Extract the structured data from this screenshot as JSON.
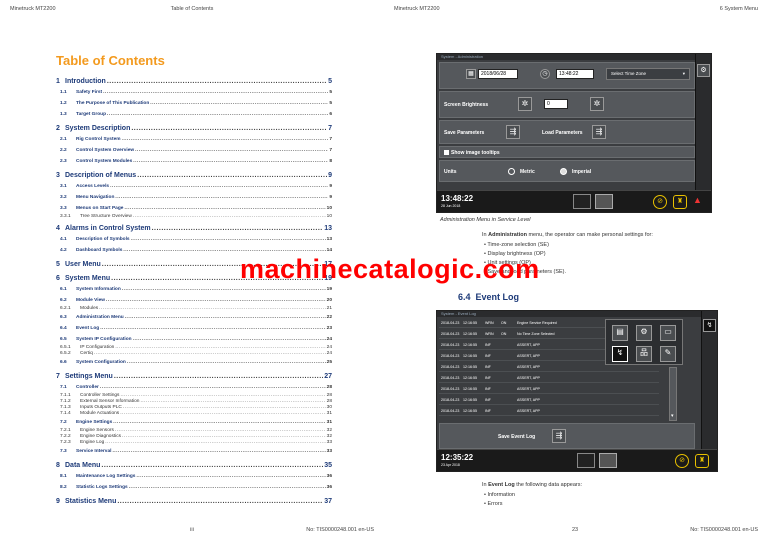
{
  "left_page": {
    "header_left": "Minetruck MT2200",
    "header_center": "Table of Contents",
    "title": "Table of Contents",
    "footer_center": "iii",
    "footer_right": "No: TIS0000248.001 en-US",
    "toc": [
      {
        "level": 1,
        "num": "1",
        "label": "Introduction",
        "page": "5"
      },
      {
        "level": 2,
        "num": "1.1",
        "label": "Safety First",
        "page": "5"
      },
      {
        "level": 2,
        "num": "1.2",
        "label": "The Purpose of This Publication",
        "page": "5"
      },
      {
        "level": 2,
        "num": "1.3",
        "label": "Target Group",
        "page": "6"
      },
      {
        "level": 1,
        "num": "2",
        "label": "System Description",
        "page": "7"
      },
      {
        "level": 2,
        "num": "2.1",
        "label": "Rig Control System",
        "page": "7"
      },
      {
        "level": 2,
        "num": "2.2",
        "label": "Control System Overview",
        "page": "7"
      },
      {
        "level": 2,
        "num": "2.3",
        "label": "Control System Modules",
        "page": "8"
      },
      {
        "level": 1,
        "num": "3",
        "label": "Description of Menus",
        "page": "9"
      },
      {
        "level": 2,
        "num": "3.1",
        "label": "Access Levels",
        "page": "9"
      },
      {
        "level": 2,
        "num": "3.2",
        "label": "Menu Navigation",
        "page": "9"
      },
      {
        "level": 2,
        "num": "3.3",
        "label": "Menus on Start Page",
        "page": "10"
      },
      {
        "level": 3,
        "num": "3.3.1",
        "label": "Tree Structure Overview",
        "page": "10"
      },
      {
        "level": 1,
        "num": "4",
        "label": "Alarms in Control System",
        "page": "13"
      },
      {
        "level": 2,
        "num": "4.1",
        "label": "Description of Symbols",
        "page": "13"
      },
      {
        "level": 2,
        "num": "4.2",
        "label": "Dashboard Symbols",
        "page": "14"
      },
      {
        "level": 1,
        "num": "5",
        "label": "User Menu",
        "page": "17"
      },
      {
        "level": 1,
        "num": "6",
        "label": "System Menu",
        "page": "19"
      },
      {
        "level": 2,
        "num": "6.1",
        "label": "System Information",
        "page": "19"
      },
      {
        "level": 2,
        "num": "6.2",
        "label": "Module View",
        "page": "20"
      },
      {
        "level": 3,
        "num": "6.2.1",
        "label": "Modules",
        "page": "21"
      },
      {
        "level": 2,
        "num": "6.3",
        "label": "Administration Menu",
        "page": "22"
      },
      {
        "level": 2,
        "num": "6.4",
        "label": "Event Log",
        "page": "23"
      },
      {
        "level": 2,
        "num": "6.5",
        "label": "System IP Configuration",
        "page": "24"
      },
      {
        "level": 3,
        "num": "6.5.1",
        "label": "IP Configuration",
        "page": "24"
      },
      {
        "level": 3,
        "num": "6.5.2",
        "label": "Certiq",
        "page": "24"
      },
      {
        "level": 2,
        "num": "6.6",
        "label": "System Configuration",
        "page": "25"
      },
      {
        "level": 1,
        "num": "7",
        "label": "Settings Menu",
        "page": "27"
      },
      {
        "level": 2,
        "num": "7.1",
        "label": "Controller",
        "page": "28"
      },
      {
        "level": 3,
        "num": "7.1.1",
        "label": "Controller Settings",
        "page": "28"
      },
      {
        "level": 3,
        "num": "7.1.2",
        "label": "External Sensor Information",
        "page": "28"
      },
      {
        "level": 3,
        "num": "7.1.3",
        "label": "Inputs Outputs PLC",
        "page": "30"
      },
      {
        "level": 3,
        "num": "7.1.4",
        "label": "Module Actuations",
        "page": "31"
      },
      {
        "level": 2,
        "num": "7.2",
        "label": "Engine Settings",
        "page": "31"
      },
      {
        "level": 3,
        "num": "7.2.1",
        "label": "Engine Sensors",
        "page": "32"
      },
      {
        "level": 3,
        "num": "7.2.2",
        "label": "Engine Diagnostics",
        "page": "32"
      },
      {
        "level": 3,
        "num": "7.2.3",
        "label": "Engine Log",
        "page": "33"
      },
      {
        "level": 2,
        "num": "7.3",
        "label": "Service Interval",
        "page": "33"
      },
      {
        "level": 1,
        "num": "8",
        "label": "Data Menu",
        "page": "35"
      },
      {
        "level": 2,
        "num": "8.1",
        "label": "Maintenance Log Settings",
        "page": "36"
      },
      {
        "level": 2,
        "num": "8.2",
        "label": "Statistic Logs Settings",
        "page": "36"
      },
      {
        "level": 1,
        "num": "9",
        "label": "Statistics Menu",
        "page": "37"
      }
    ]
  },
  "right_page": {
    "header_left": "Minetruck MT2200",
    "header_right": "6 System Menu",
    "footer_left": "23",
    "footer_right": "No: TIS0000248.001 en-US",
    "admin_screen": {
      "breadcrumb": "System - Administration",
      "date": "2018/06/28",
      "time": "13:48:22",
      "tz_button": "Select Time Zone",
      "brightness_label": "Screen Brightness",
      "brightness_value": "0",
      "save_params": "Save Parameters",
      "load_params": "Load Parameters",
      "tooltips": "Show image tooltips",
      "units_label": "Units",
      "metric": "Metric",
      "imperial": "Imperial",
      "clock": "13:48:22",
      "clock_date": "28 Jun 2018"
    },
    "admin_caption": "Administration Menu in Service Level",
    "admin_intro_1": "In ",
    "admin_intro_bold": "Administration",
    "admin_intro_2": " menu, the operator can make personal settings for:",
    "admin_bullets": [
      "Time-zone selection (SE)",
      "Display brightness (OP)",
      "Unit settings (OP)",
      "Save and load parameters (SE)."
    ],
    "event_section_num": "6.4",
    "event_section_title": "Event Log",
    "event_screen": {
      "breadcrumb": "System - Event Log",
      "rows": [
        {
          "date": "2018-04-23",
          "time": "12:16:55",
          "level": "WRN",
          "state": "ON",
          "msg": "Engine Service Required"
        },
        {
          "date": "2018-04-23",
          "time": "12:16:55",
          "level": "WRN",
          "state": "ON",
          "msg": "No Time Zone Selected"
        },
        {
          "date": "2018-04-23",
          "time": "12:16:55",
          "level": "INF",
          "state": "",
          "msg": "ASSERT, APP"
        },
        {
          "date": "2018-04-23",
          "time": "12:16:55",
          "level": "INF",
          "state": "",
          "msg": "ASSERT, APP"
        },
        {
          "date": "2018-04-23",
          "time": "12:16:55",
          "level": "INF",
          "state": "",
          "msg": "ASSERT, APP"
        },
        {
          "date": "2018-04-23",
          "time": "12:16:55",
          "level": "INF",
          "state": "",
          "msg": "ASSERT, APP"
        },
        {
          "date": "2018-04-23",
          "time": "12:16:55",
          "level": "INF",
          "state": "",
          "msg": "ASSERT, APP"
        },
        {
          "date": "2018-04-23",
          "time": "12:16:55",
          "level": "INF",
          "state": "",
          "msg": "ASSERT, APP"
        },
        {
          "date": "2018-04-23",
          "time": "12:16:55",
          "level": "INF",
          "state": "",
          "msg": "ASSERT, APP"
        }
      ],
      "save_log": "Save Event Log",
      "clock": "12:35:22",
      "clock_date": "23 Apr 2018"
    },
    "event_intro_1": "In ",
    "event_intro_bold": "Event Log",
    "event_intro_2": " the following data appears:",
    "event_bullets": [
      "Information",
      "Errors"
    ]
  },
  "watermark": "machinecatalogic.com",
  "colors": {
    "toc_title": "#f39a1e",
    "heading_blue": "#1d3a78",
    "watermark": "#ff0000",
    "screen_bg": "#3b3d40"
  }
}
